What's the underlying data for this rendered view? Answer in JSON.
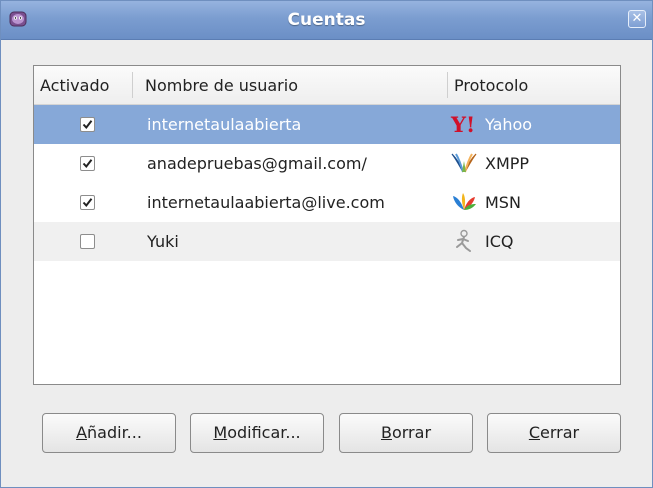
{
  "window": {
    "title": "Cuentas"
  },
  "columns": {
    "enabled": "Activado",
    "username": "Nombre de usuario",
    "protocol": "Protocolo"
  },
  "accounts": [
    {
      "enabled": true,
      "username": "internetaulaabierta",
      "protocol": "Yahoo",
      "icon": "yahoo-icon",
      "selected": true
    },
    {
      "enabled": true,
      "username": "anadepruebas@gmail.com/",
      "protocol": "XMPP",
      "icon": "xmpp-icon"
    },
    {
      "enabled": true,
      "username": "internetaulaabierta@live.com",
      "protocol": "MSN",
      "icon": "msn-icon"
    },
    {
      "enabled": false,
      "username": "Yuki",
      "protocol": "ICQ",
      "icon": "icq-icon"
    }
  ],
  "buttons": {
    "add": {
      "mnemonic": "A",
      "rest": "ñadir..."
    },
    "modify": {
      "mnemonic": "M",
      "rest": "odificar..."
    },
    "delete": {
      "mnemonic": "B",
      "rest": "orrar"
    },
    "close": {
      "mnemonic": "C",
      "rest": "errar"
    }
  },
  "colors": {
    "titlebar": "#7b9dd0",
    "selection": "#86a8d8",
    "yahoo": "#d0102a"
  }
}
